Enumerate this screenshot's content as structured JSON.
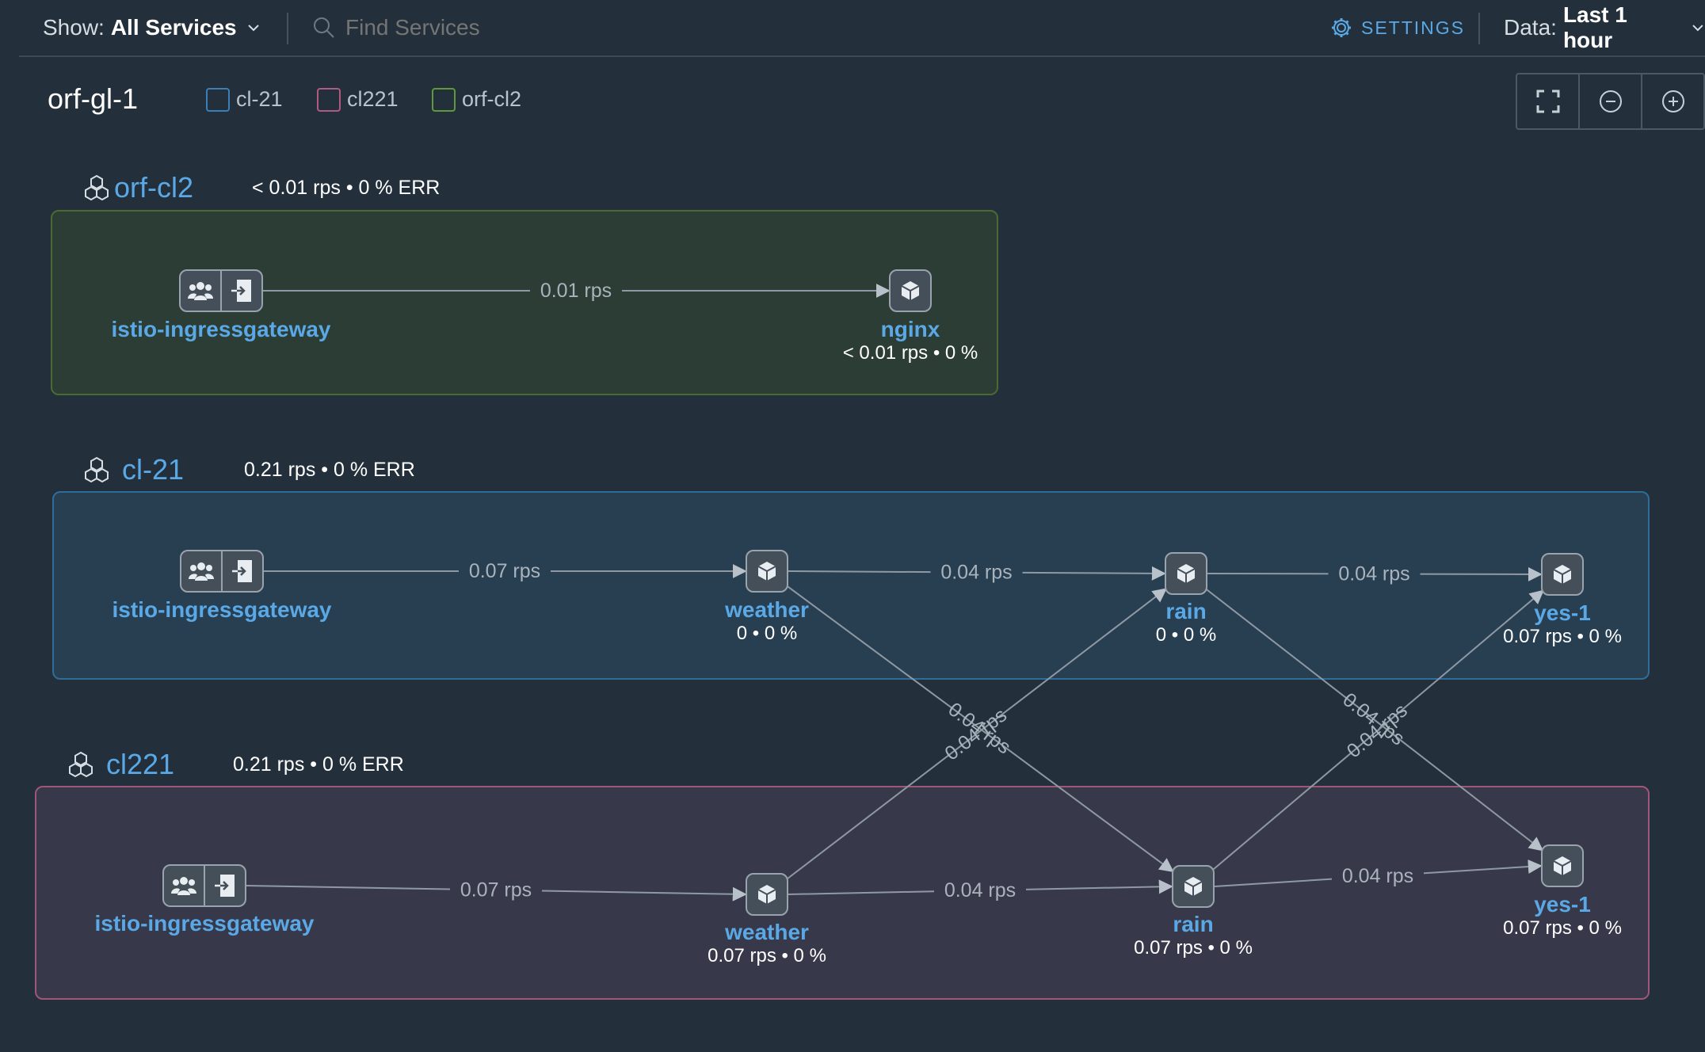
{
  "toolbar": {
    "show_label": "Show:",
    "show_value": "All Services",
    "search_placeholder": "Find Services",
    "settings_label": "SETTINGS",
    "data_label": "Data:",
    "data_value": "Last 1 hour"
  },
  "graph_title": "orf-gl-1",
  "legend": [
    {
      "label": "cl-21",
      "color": "#3a7fb8"
    },
    {
      "label": "cl221",
      "color": "#b05a80"
    },
    {
      "label": "orf-cl2",
      "color": "#5f9a3a"
    }
  ],
  "clusters": {
    "orfcl2": {
      "name": "orf-cl2",
      "stats": "< 0.01 rps • 0 % ERR"
    },
    "cl21": {
      "name": "cl-21",
      "stats": "0.21 rps • 0 % ERR"
    },
    "cl221": {
      "name": "cl221",
      "stats": "0.21 rps • 0 % ERR"
    }
  },
  "nodes": {
    "orf_gw": {
      "name": "istio-ingressgateway"
    },
    "orf_nginx": {
      "name": "nginx",
      "stats": "< 0.01 rps • 0 %"
    },
    "c21_gw": {
      "name": "istio-ingressgateway"
    },
    "c21_weather": {
      "name": "weather",
      "stats": "0 • 0 %"
    },
    "c21_rain": {
      "name": "rain",
      "stats": "0 • 0 %"
    },
    "c21_yes": {
      "name": "yes-1",
      "stats": "0.07 rps • 0 %"
    },
    "c221_gw": {
      "name": "istio-ingressgateway"
    },
    "c221_weather": {
      "name": "weather",
      "stats": "0.07 rps • 0 %"
    },
    "c221_rain": {
      "name": "rain",
      "stats": "0.07 rps • 0 %"
    },
    "c221_yes": {
      "name": "yes-1",
      "stats": "0.07 rps • 0 %"
    }
  },
  "edges": [
    {
      "from": "orf_gw",
      "to": "orf_nginx",
      "label": "0.01 rps"
    },
    {
      "from": "c21_gw",
      "to": "c21_weather",
      "label": "0.07 rps"
    },
    {
      "from": "c21_weather",
      "to": "c21_rain",
      "label": "0.04 rps"
    },
    {
      "from": "c21_rain",
      "to": "c21_yes",
      "label": "0.04 rps"
    },
    {
      "from": "c21_weather",
      "to": "c221_rain",
      "label": "0.04 rps"
    },
    {
      "from": "c221_weather",
      "to": "c21_rain",
      "label": "0.04 rps"
    },
    {
      "from": "c21_rain",
      "to": "c221_yes",
      "label": "0.04 rps"
    },
    {
      "from": "c221_rain",
      "to": "c21_yes",
      "label": "0.04 rps"
    },
    {
      "from": "c221_gw",
      "to": "c221_weather",
      "label": "0.07 rps"
    },
    {
      "from": "c221_weather",
      "to": "c221_rain",
      "label": "0.04 rps"
    },
    {
      "from": "c221_rain",
      "to": "c221_yes",
      "label": "0.04 rps"
    }
  ],
  "colors": {
    "accent": "#5aa9e6",
    "cluster_cl21_fill": "#283f52",
    "cluster_cl221_fill": "#37394a",
    "cluster_orfcl2_fill": "#2c3d36"
  },
  "icons": [
    "chevron-down-icon",
    "search-icon",
    "gear-icon",
    "fit-screen-icon",
    "zoom-out-icon",
    "zoom-in-icon",
    "cluster-icon",
    "users-icon",
    "gateway-enter-icon",
    "service-box-icon"
  ]
}
